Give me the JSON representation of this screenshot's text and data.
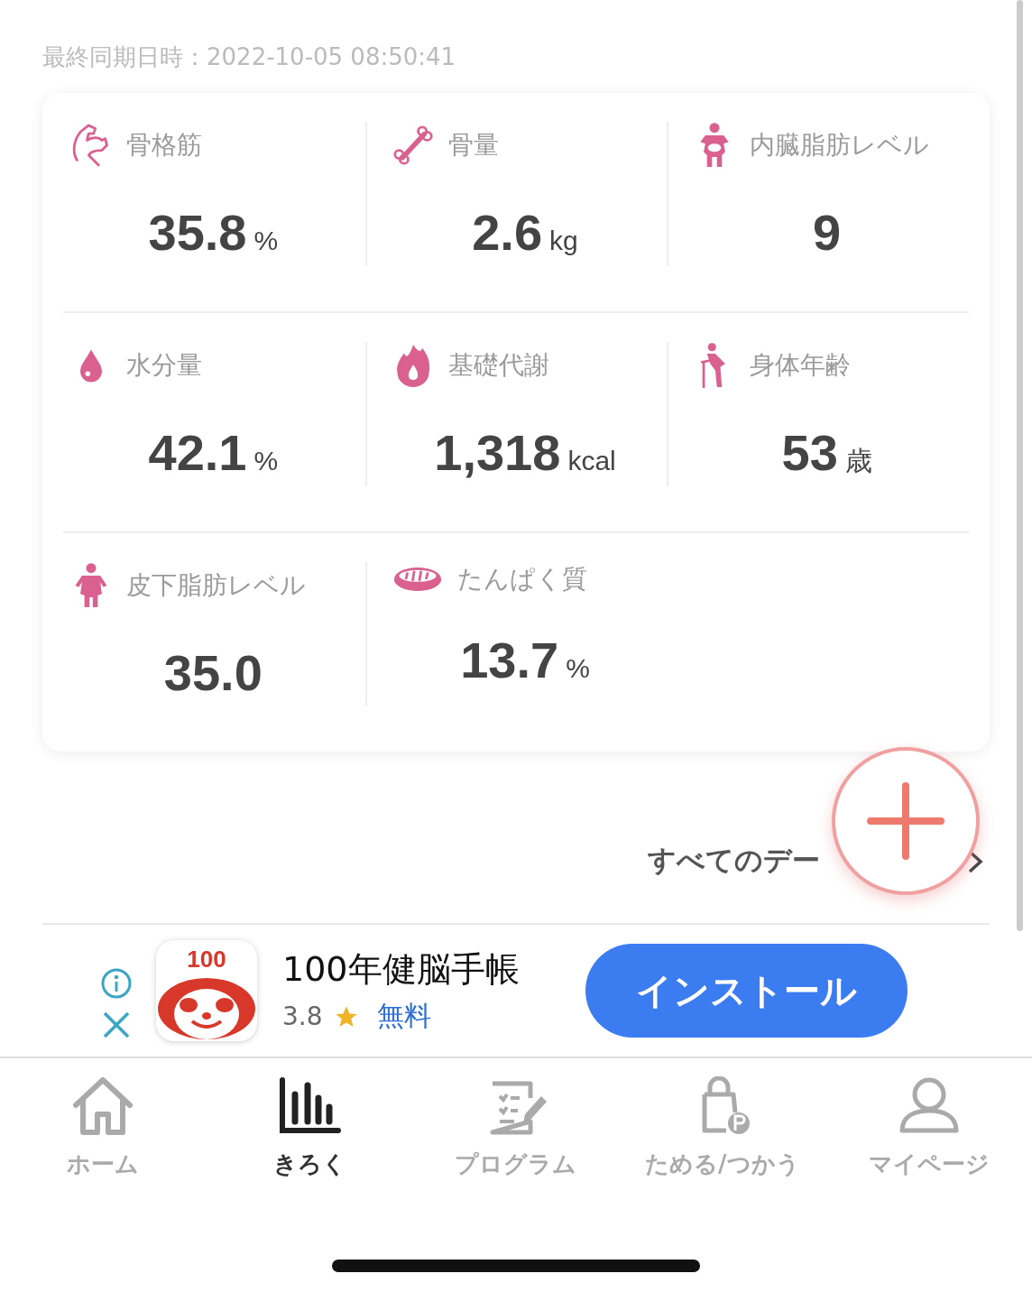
{
  "sync_time": "最終同期日時：2022-10-05 08:50:41",
  "metrics": [
    {
      "kind": "muscle",
      "label": "骨格筋",
      "value": "35.8",
      "unit": "%"
    },
    {
      "kind": "bone",
      "label": "骨量",
      "value": "2.6",
      "unit": "kg"
    },
    {
      "kind": "visceral",
      "label": "内臓脂肪レベル",
      "value": "9"
    },
    {
      "kind": "water",
      "label": "水分量",
      "value": "42.1",
      "unit": "%"
    },
    {
      "kind": "flame",
      "label": "基礎代謝",
      "value": "1,318",
      "unit": "kcal"
    },
    {
      "kind": "age",
      "label": "身体年齢",
      "value": "53",
      "unit": "歳"
    },
    {
      "kind": "subcutaneous",
      "label": "皮下脂肪レベル",
      "value": "35.0"
    },
    {
      "kind": "meat",
      "label": "たんぱく質",
      "value": "13.7",
      "unit": "%"
    }
  ],
  "all_data_link": "すべてのデー",
  "ad": {
    "app_icon_text": "100",
    "title": "100年健脳手帳",
    "rating": "3.8",
    "price": "無料",
    "button": "インストール"
  },
  "nav": [
    {
      "kind": "home",
      "label": "ホーム",
      "selected": false
    },
    {
      "kind": "chart",
      "label": "きろく",
      "selected": true
    },
    {
      "kind": "program",
      "label": "プログラム",
      "selected": false
    },
    {
      "kind": "points",
      "label": "ためる/つかう",
      "selected": false
    },
    {
      "kind": "profile",
      "label": "マイページ",
      "selected": false
    }
  ]
}
